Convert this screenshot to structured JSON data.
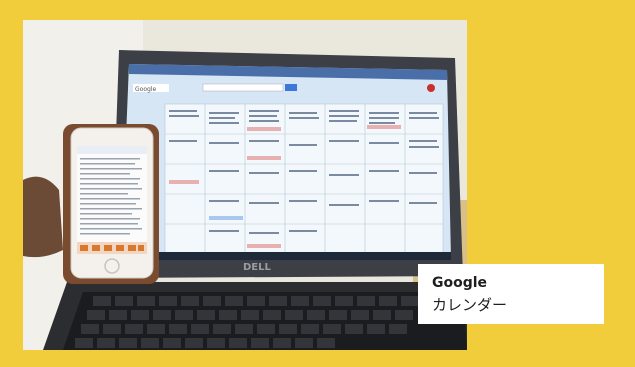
{
  "caption": {
    "brand": "Google",
    "subtitle": "カレンダー"
  },
  "photo": {
    "subject": "laptop-and-smartphone-showing-calendar",
    "laptop_brand": "DELL",
    "screen_app": "Google",
    "colors": {
      "border": "#f1cc3b",
      "caption_bg": "#ffffff",
      "caption_text": "#1f1f1f"
    }
  }
}
